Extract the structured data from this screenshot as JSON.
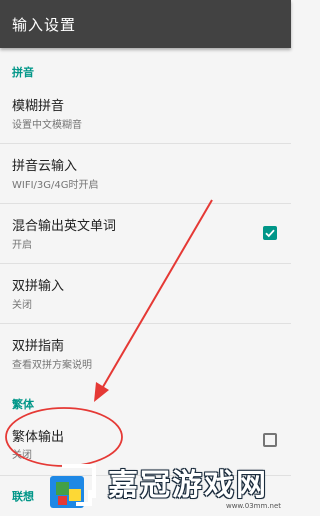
{
  "header": {
    "title": "输入设置"
  },
  "sections": [
    {
      "header": "拼音"
    },
    {
      "header": "繁体"
    },
    {
      "header": "联想"
    }
  ],
  "rows": [
    {
      "title": "模糊拼音",
      "subtitle": "设置中文模糊音"
    },
    {
      "title": "拼音云输入",
      "subtitle": "WIFI/3G/4G时开启"
    },
    {
      "title": "混合输出英文单词",
      "subtitle": "开启",
      "checked": true
    },
    {
      "title": "双拼输入",
      "subtitle": "关闭"
    },
    {
      "title": "双拼指南",
      "subtitle": "查看双拼方案说明"
    },
    {
      "title": "繁体输出",
      "subtitle": "关闭",
      "checked": false
    }
  ],
  "colors": {
    "accent": "#009688",
    "toolbar": "#424242",
    "annotation": "#e53935"
  },
  "watermark": {
    "text": "嘉冠游戏网",
    "url": "www.03mm.net"
  }
}
